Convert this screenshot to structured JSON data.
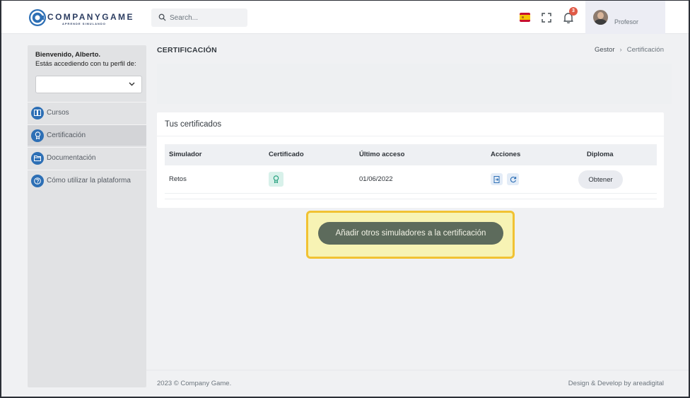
{
  "header": {
    "logo_text": "COMPANYGAME",
    "logo_tagline": "APRENDE SIMULANDO",
    "search_placeholder": "Search...",
    "notification_count": "3",
    "user_role": "Profesor",
    "language_flag": "flag-es-icon"
  },
  "sidebar": {
    "welcome": "Bienvenido, Alberto.",
    "welcome_sub": "Estás accediendo con tu perfil de:",
    "profile_selected": "",
    "items": [
      {
        "label": "Cursos",
        "icon": "book-icon",
        "active": false
      },
      {
        "label": "Certificación",
        "icon": "award-icon",
        "active": true
      },
      {
        "label": "Documentación",
        "icon": "folder-icon",
        "active": false
      },
      {
        "label": "Cómo utilizar la plataforma",
        "icon": "help-icon",
        "active": false
      }
    ]
  },
  "main": {
    "page_title": "CERTIFICACIÓN",
    "breadcrumb": [
      "Gestor",
      "Certificación"
    ],
    "card_title": "Tus certificados",
    "table": {
      "columns": [
        "Simulador",
        "Certificado",
        "Último acceso",
        "Acciones",
        "Diploma"
      ],
      "rows": [
        {
          "simulador": "Retos",
          "certificado": "award-icon",
          "ultimo_acceso": "01/06/2022",
          "acciones": [
            "export-icon",
            "refresh-icon"
          ],
          "diploma": "Obtener"
        }
      ]
    },
    "add_button": "Añadir otros simuladores a la certificación"
  },
  "footer": {
    "copyright": "2023 © Company Game.",
    "credit": "Design & Develop by areadigital"
  },
  "colors": {
    "accent_blue": "#2d6fb5",
    "highlight_yellow": "#f1c232",
    "button_dark": "#5d6b5c",
    "badge_red": "#e05a47"
  }
}
